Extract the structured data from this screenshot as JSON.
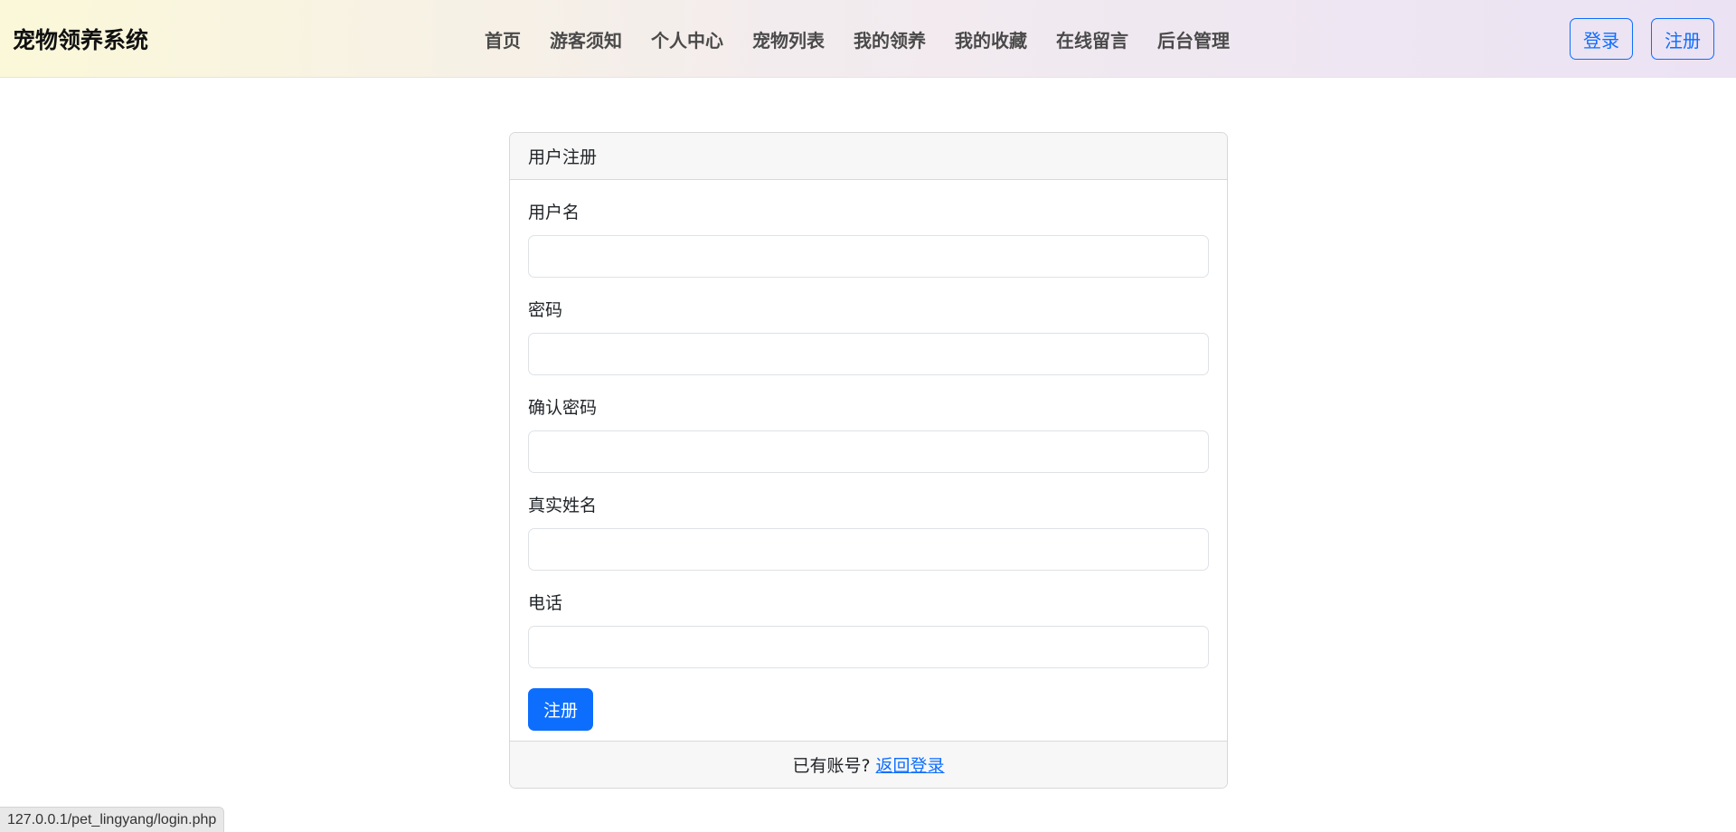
{
  "navbar": {
    "brand": "宠物领养系统",
    "links": [
      "首页",
      "游客须知",
      "个人中心",
      "宠物列表",
      "我的领养",
      "我的收藏",
      "在线留言",
      "后台管理"
    ],
    "login_label": "登录",
    "register_label": "注册"
  },
  "form": {
    "title": "用户注册",
    "fields": [
      {
        "label": "用户名",
        "value": ""
      },
      {
        "label": "密码",
        "value": ""
      },
      {
        "label": "确认密码",
        "value": ""
      },
      {
        "label": "真实姓名",
        "value": ""
      },
      {
        "label": "电话",
        "value": ""
      }
    ],
    "submit_label": "注册",
    "footer_text": "已有账号?",
    "footer_link": "返回登录"
  },
  "status_bar": {
    "url": "127.0.0.1/pet_lingyang/login.php"
  },
  "colors": {
    "primary": "#0d6efd",
    "navbar_gradient_start": "#fbf8d9",
    "navbar_gradient_end": "#ebe2f4"
  }
}
